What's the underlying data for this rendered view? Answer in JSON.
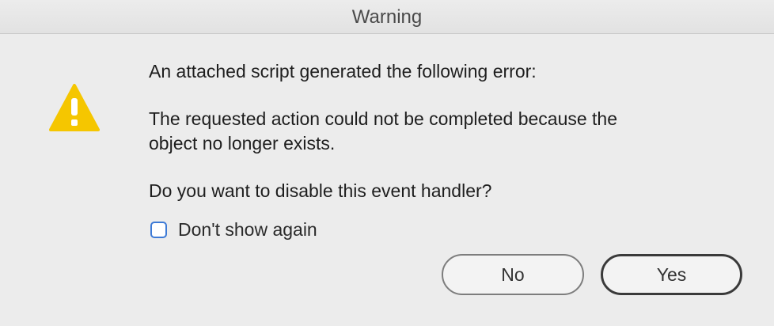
{
  "window": {
    "title": "Warning"
  },
  "icon": {
    "name": "warning-icon",
    "color": "#f5c600"
  },
  "message": {
    "line1": "An attached script generated the following error:",
    "line2": "The requested action could not be completed because the",
    "line3": "object no longer exists.",
    "line4": "Do you want to disable this event handler?"
  },
  "checkbox": {
    "label": "Don't show again",
    "checked": false
  },
  "buttons": {
    "no_label": "No",
    "yes_label": "Yes"
  },
  "colors": {
    "accent": "#3d7ad6",
    "warning": "#f5c600"
  }
}
